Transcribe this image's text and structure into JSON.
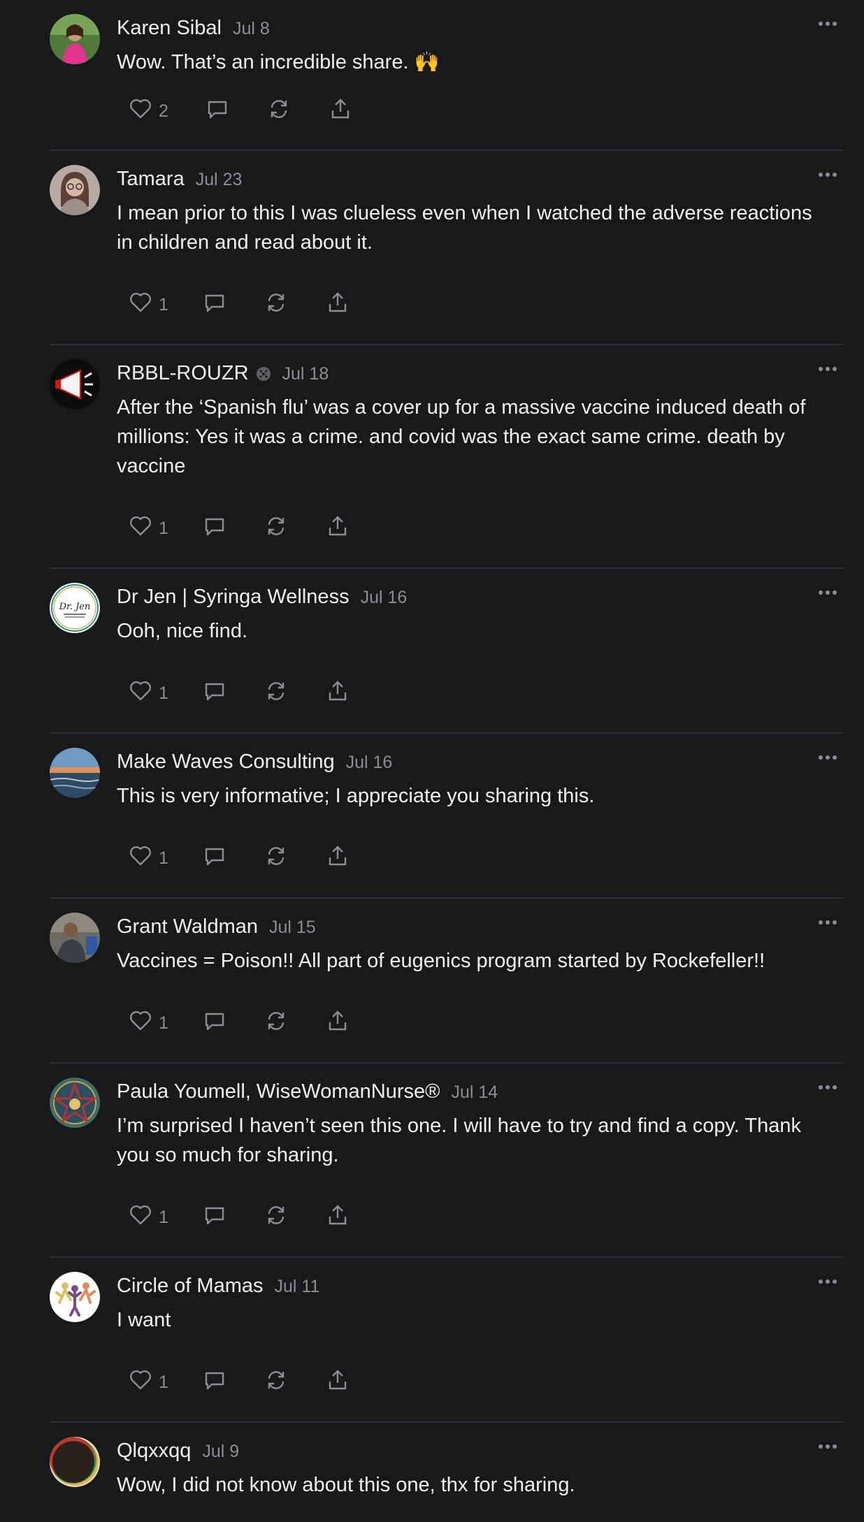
{
  "comments": [
    {
      "name": "Karen Sibal",
      "date": "Jul 8",
      "text": "Wow. That’s an incredible share. 🙌",
      "likes": "2",
      "avatar": "woman-pink-shirt-outdoors",
      "badge": false
    },
    {
      "name": "Tamara",
      "date": "Jul 23",
      "text": "I mean prior to this I was clueless even when I watched the adverse reactions in children and read about it.",
      "likes": "1",
      "avatar": "woman-glasses-portrait",
      "badge": false
    },
    {
      "name": "RBBL-ROUZR",
      "date": "Jul 18",
      "text": "After the ‘Spanish flu’ was a cover up for a massive vaccine induced death of millions: Yes it was a crime. and covid was the exact same crime. death by vaccine",
      "likes": "1",
      "avatar": "megaphone-logo",
      "badge": true
    },
    {
      "name": "Dr Jen | Syringa Wellness",
      "date": "Jul 16",
      "text": "Ooh, nice find.",
      "likes": "1",
      "avatar": "dr-jen-logo",
      "badge": false,
      "avatar_text": "Dr. Jen"
    },
    {
      "name": "Make Waves Consulting",
      "date": "Jul 16",
      "text": "This is very informative; I appreciate you sharing this.",
      "likes": "1",
      "avatar": "ocean-sunset",
      "badge": false
    },
    {
      "name": "Grant Waldman",
      "date": "Jul 15",
      "text": "Vaccines = Poison!! All part of eugenics program started by Rockefeller!!",
      "likes": "1",
      "avatar": "man-outdoors-photo",
      "badge": false
    },
    {
      "name": "Paula Youmell, WiseWomanNurse®",
      "date": "Jul 14",
      "text": "I’m surprised I haven’t seen this one. I will have to try and find a copy. Thank you so much for sharing.",
      "likes": "1",
      "avatar": "star-emblem",
      "badge": false
    },
    {
      "name": "Circle of Mamas",
      "date": "Jul 11",
      "text": "I want",
      "likes": "1",
      "avatar": "dancing-figures-logo",
      "badge": false
    },
    {
      "name": "Qlqxxqq",
      "date": "Jul 9",
      "text": "Wow, I did not know about this one, thx for sharing.",
      "likes": "",
      "avatar": "dark-circle-rainbow-edge",
      "badge": false
    }
  ],
  "icons": {
    "like": "heart-icon",
    "reply": "comment-bubble-icon",
    "restack": "restack-icon",
    "share": "share-icon",
    "more": "more-dots-icon"
  },
  "colors": {
    "background": "#18191b",
    "divider": "#2c2d30",
    "text": "#f0f0f0",
    "muted": "#8d8e92"
  }
}
